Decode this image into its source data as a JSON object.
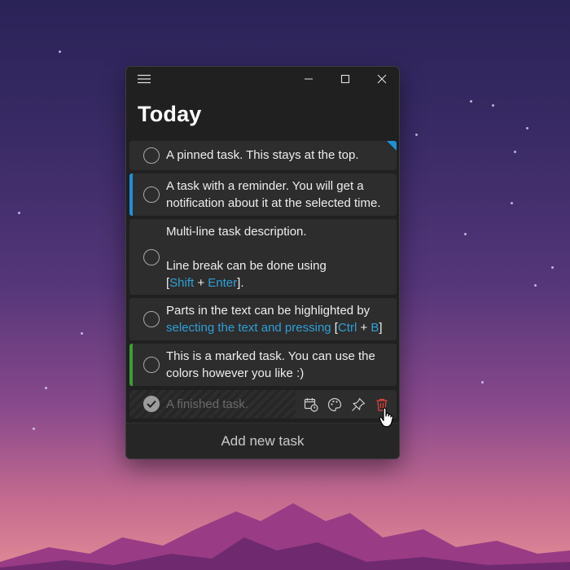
{
  "window": {
    "heading": "Today",
    "controls": {
      "menu": "hamburger-icon",
      "minimize": "minimize-icon",
      "maximize": "maximize-icon",
      "close": "close-icon"
    }
  },
  "tasks": [
    {
      "lines": [
        [
          {
            "t": "A pinned task. This stays at the top."
          }
        ]
      ],
      "pinned": true,
      "accent": null
    },
    {
      "lines": [
        [
          {
            "t": "A task with a reminder. You will get a"
          }
        ],
        [
          {
            "t": "notification about it at the selected time."
          }
        ]
      ],
      "accent": "#1e90d6"
    },
    {
      "lines": [
        [
          {
            "t": "Multi-line task description."
          }
        ],
        [
          {
            "t": ""
          }
        ],
        [
          {
            "t": "Line break can be done using"
          }
        ],
        [
          {
            "t": "["
          },
          {
            "t": "Shift",
            "hl": true
          },
          {
            "t": " + "
          },
          {
            "t": "Enter",
            "hl": true
          },
          {
            "t": "]."
          }
        ]
      ],
      "accent": null
    },
    {
      "lines": [
        [
          {
            "t": "Parts in the text can be highlighted by"
          }
        ],
        [
          {
            "t": "selecting the text and pressing",
            "hl": true
          },
          {
            "t": " ["
          },
          {
            "t": "Ctrl",
            "hl": true
          },
          {
            "t": " + "
          },
          {
            "t": "B",
            "hl": true
          },
          {
            "t": "]"
          }
        ]
      ],
      "accent": null
    },
    {
      "lines": [
        [
          {
            "t": "This is a marked task. You can use the"
          }
        ],
        [
          {
            "t": "colors however you like :)"
          }
        ]
      ],
      "accent": "#3f9c35"
    }
  ],
  "finished_task": {
    "text": "A finished task.",
    "actions": [
      "calendar-clock-icon",
      "palette-icon",
      "pin-icon",
      "trash-icon"
    ]
  },
  "add_button": {
    "label": "Add new task"
  },
  "colors": {
    "window_bg": "#202020",
    "task_bg": "#2d2d2d",
    "highlight": "#2f9fd8",
    "delete": "#e0413c"
  }
}
